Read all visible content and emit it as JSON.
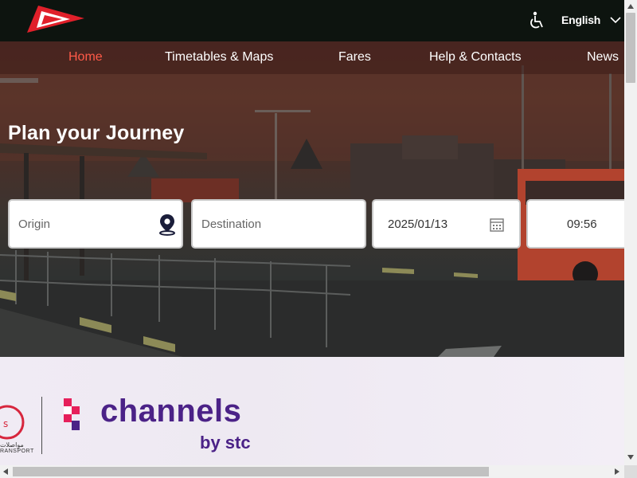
{
  "header": {
    "language": "English",
    "icons": [
      "logo-icon",
      "accessibility-icon",
      "chevron-down-icon"
    ]
  },
  "nav": {
    "items": [
      {
        "label": "Home",
        "active": true
      },
      {
        "label": "Timetables & Maps"
      },
      {
        "label": "Fares"
      },
      {
        "label": "Help & Contacts"
      },
      {
        "label": "News"
      }
    ]
  },
  "planner": {
    "title": "Plan your Journey",
    "origin_placeholder": "Origin",
    "destination_placeholder": "Destination",
    "date": "2025/01/13",
    "time": "09:56"
  },
  "banner": {
    "partner_arabic": "مواصلات",
    "partner_english": "RANSPORT",
    "brand": "channels",
    "brand_by": "by stc"
  },
  "colors": {
    "topbar": "#0d140f",
    "active_nav": "#ff5a48",
    "logo_red": "#e0202a",
    "brand_purple": "#4b2287",
    "brand_pink": "#e6205b"
  }
}
